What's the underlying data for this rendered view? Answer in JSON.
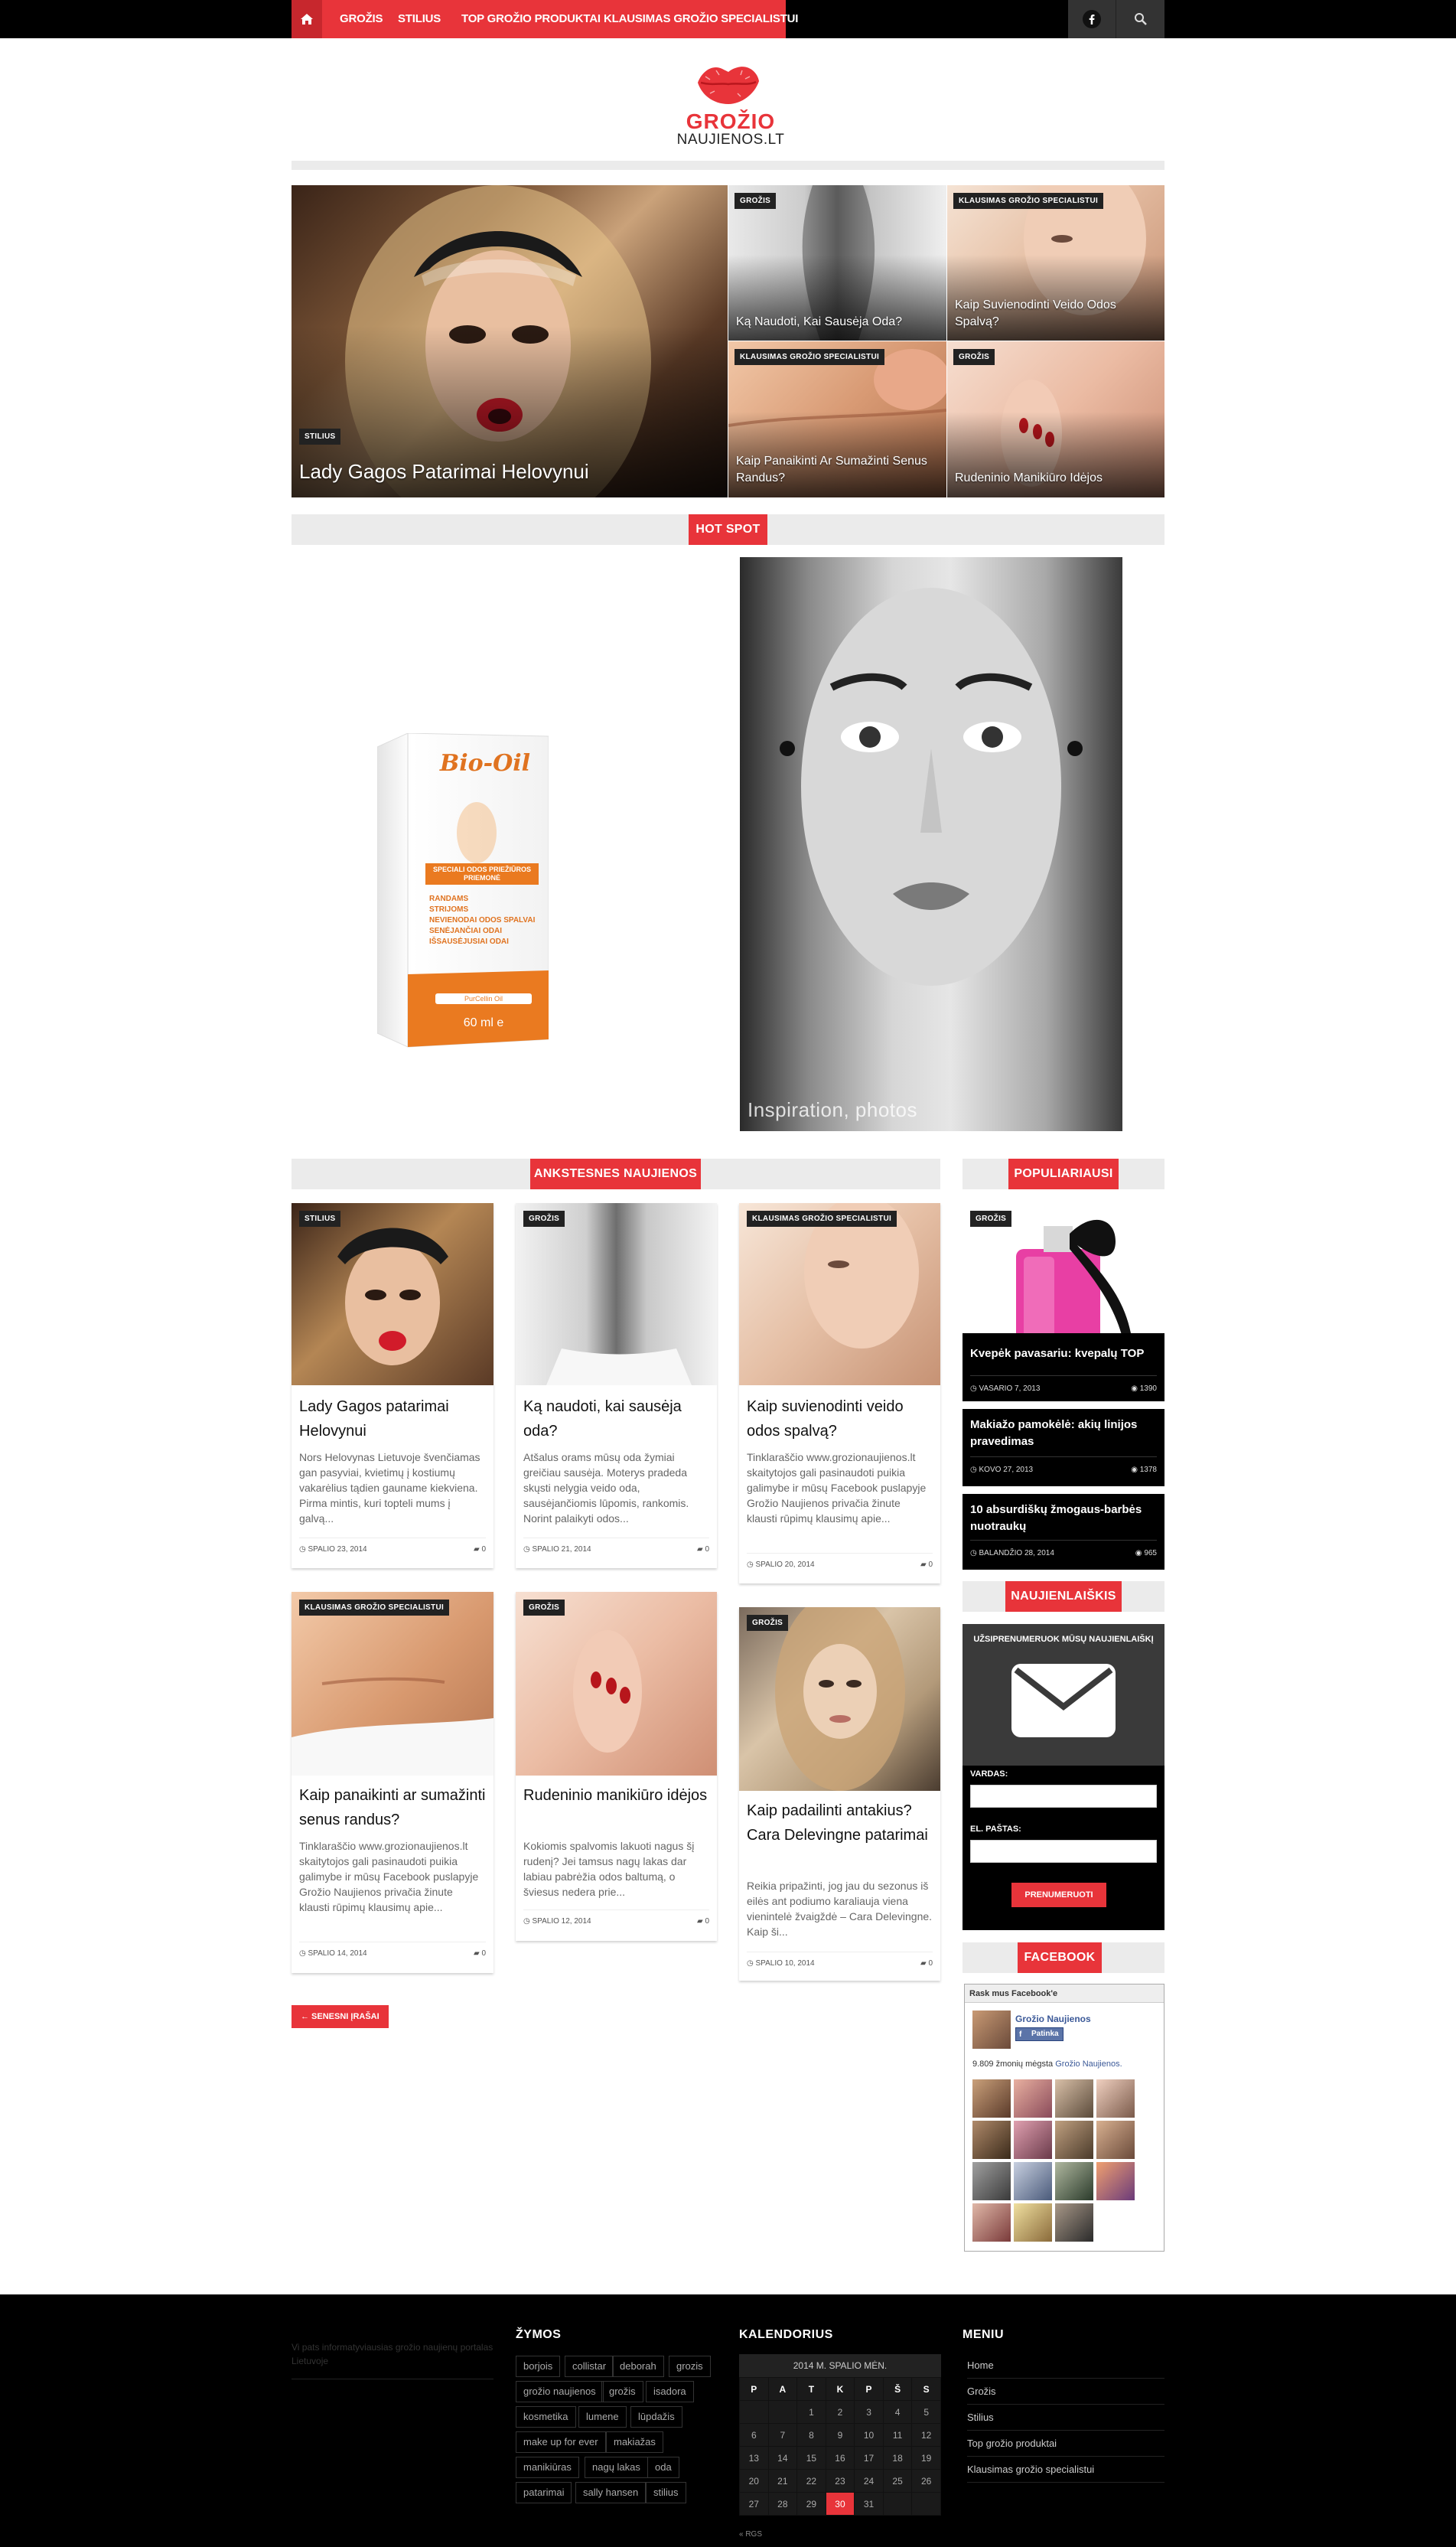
{
  "nav": {
    "home_icon": "home-icon",
    "items": [
      "GROŽIS",
      "STILIUS",
      "TOP GROŽIO PRODUKTAI",
      "KLAUSIMAS GROŽIO SPECIALISTUI"
    ],
    "facebook_icon": "facebook-icon",
    "search_icon": "search-icon"
  },
  "logo": {
    "line1": "GROŽIO",
    "line2": "NAUJIENOS.LT"
  },
  "featured": {
    "main": {
      "tag": "STILIUS",
      "title": "Lady Gagos Patarimai Helovynui"
    },
    "items": [
      {
        "tag": "GROŽIS",
        "title": "Ką Naudoti, Kai Sausėja Oda?"
      },
      {
        "tag": "KLAUSIMAS GROŽIO SPECIALISTUI",
        "title": "Kaip Suvienodinti Veido Odos Spalvą?"
      },
      {
        "tag": "KLAUSIMAS GROŽIO SPECIALISTUI",
        "title": "Kaip Panaikinti Ar Sumažinti Senus Randus?"
      },
      {
        "tag": "GROŽIS",
        "title": "Rudeninio Manikiūro Idėjos"
      }
    ]
  },
  "hotspot": {
    "label": "HOT SPOT",
    "ad": {
      "brand": "Bio-Oil",
      "badge": "SPECIALI ODOS PRIEŽIŪROS PRIEMONĖ",
      "lines": [
        "RANDAMS",
        "STRIJOMS",
        "NEVIENODAI ODOS SPALVAI",
        "SENĖJANČIAI ODAI",
        "IŠSAUSĖJUSIAI ODAI"
      ],
      "note": "PurCellin Oil",
      "volume": "60 ml e"
    },
    "caption": "Inspiration, photos"
  },
  "older": {
    "label": "ANKSTESNES NAUJIENOS",
    "posts": [
      {
        "tag": "STILIUS",
        "title": "Lady Gagos patarimai Helovynui",
        "excerpt": "Nors Helovynas Lietuvoje švenčiamas gan pasyviai, kvietimų į kostiumų vakarėlius tądien gauname kiekviena. Pirma mintis, kuri topteli mums į galvą...",
        "date": "SPALIO 23, 2014",
        "comments": "0"
      },
      {
        "tag": "GROŽIS",
        "title": "Ką naudoti, kai sausėja oda?",
        "excerpt": "Atšalus orams mūsų oda žymiai greičiau sausėja. Moterys pradeda skųsti nelygia veido oda, sausėjančiomis lūpomis, rankomis. Norint palaikyti odos...",
        "date": "SPALIO 21, 2014",
        "comments": "0"
      },
      {
        "tag": "KLAUSIMAS GROŽIO SPECIALISTUI",
        "title": "Kaip suvienodinti veido odos spalvą?",
        "excerpt": "Tinklaraščio www.grozionaujienos.lt skaitytojos gali pasinaudoti puikia galimybe ir mūsų Facebook puslapyje Grožio Naujienos privačia žinute klausti rūpimų klausimų apie...",
        "date": "SPALIO 20, 2014",
        "comments": "0"
      },
      {
        "tag": "KLAUSIMAS GROŽIO SPECIALISTUI",
        "title": "Kaip panaikinti ar sumažinti senus randus?",
        "excerpt": "Tinklaraščio www.grozionaujienos.lt skaitytojos gali pasinaudoti puikia galimybe ir mūsų Facebook puslapyje Grožio Naujienos privačia žinute klausti rūpimų klausimų apie...",
        "date": "SPALIO 14, 2014",
        "comments": "0"
      },
      {
        "tag": "GROŽIS",
        "title": "Rudeninio manikiūro idėjos",
        "excerpt": "Kokiomis spalvomis lakuoti nagus šį rudenį? Jei tamsus nagų lakas dar labiau pabrėžia odos baltumą, o šviesus nedera prie...",
        "date": "SPALIO 12, 2014",
        "comments": "0"
      },
      {
        "tag": "GROŽIS",
        "title": "Kaip padailinti antakius? Cara Delevingne patarimai",
        "excerpt": "Reikia pripažinti, jog jau du sezonus iš eilės ant podiumo karaliauja viena vienintelė žvaigždė – Cara Delevingne. Kaip ši...",
        "date": "SPALIO 10, 2014",
        "comments": "0"
      }
    ],
    "older_button": "← SENESNI ĮRAŠAI"
  },
  "popular": {
    "label": "POPULIARIAUSI",
    "tag": "GROŽIS",
    "items": [
      {
        "title": "Kvepėk pavasariu: kvepalų TOP",
        "date": "VASARIO 7, 2013",
        "views": "1390"
      },
      {
        "title": "Makiažo pamokėlė: akių linijos pravedimas",
        "date": "KOVO 27, 2013",
        "views": "1378"
      },
      {
        "title": "10 absurdiškų žmogaus-barbės nuotraukų",
        "date": "BALANDŽIO 28, 2014",
        "views": "965"
      }
    ]
  },
  "newsletter": {
    "label": "NAUJIENLAIŠKIS",
    "heading": "UŽSIPRENUMERUOK MŪSŲ NAUJIENLAIŠKĮ",
    "name_label": "VARDAS:",
    "email_label": "EL. PAŠTAS:",
    "submit": "PRENUMERUOTI",
    "envelope_icon": "envelope-icon"
  },
  "facebook": {
    "label": "FACEBOOK",
    "find_us": "Rask mus Facebook'e",
    "page_name": "Grožio Naujienos",
    "like": "Patinka",
    "fans_prefix": "9.809 žmonių mėgsta",
    "fans_page": "Grožio Naujienos."
  },
  "footer": {
    "about": "Vi pats informatyviausias grožio naujienų portalas Lietuvoje",
    "tags_heading": "ŽYMOS",
    "tags": [
      "borjois",
      "collistar",
      "deborah",
      "grozis",
      "grožio naujienos",
      "grožis",
      "isadora",
      "kosmetika",
      "lumene",
      "lūpdažis",
      "make up for ever",
      "makiažas",
      "manikiūras",
      "nagų lakas",
      "oda",
      "patarimai",
      "sally hansen",
      "stilius"
    ],
    "calendar_heading": "KALENDORIUS",
    "calendar_caption": "2014 M. SPALIO MĖN.",
    "calendar_days": [
      "P",
      "A",
      "T",
      "K",
      "P",
      "Š",
      "S"
    ],
    "calendar_rows": [
      [
        "",
        "",
        "1",
        "2",
        "3",
        "4",
        "5"
      ],
      [
        "6",
        "7",
        "8",
        "9",
        "10",
        "11",
        "12"
      ],
      [
        "13",
        "14",
        "15",
        "16",
        "17",
        "18",
        "19"
      ],
      [
        "20",
        "21",
        "22",
        "23",
        "24",
        "25",
        "26"
      ],
      [
        "27",
        "28",
        "29",
        "30",
        "31",
        "",
        ""
      ]
    ],
    "calendar_prev": "« RGS",
    "menu_heading": "MENIU",
    "menu": [
      "Home",
      "Grožis",
      "Stilius",
      "Top grožio produktai",
      "Klausimas grožio specialistui"
    ]
  },
  "colors": {
    "accent": "#e8343a",
    "dark": "#000000",
    "light_bar": "#ebebeb"
  }
}
